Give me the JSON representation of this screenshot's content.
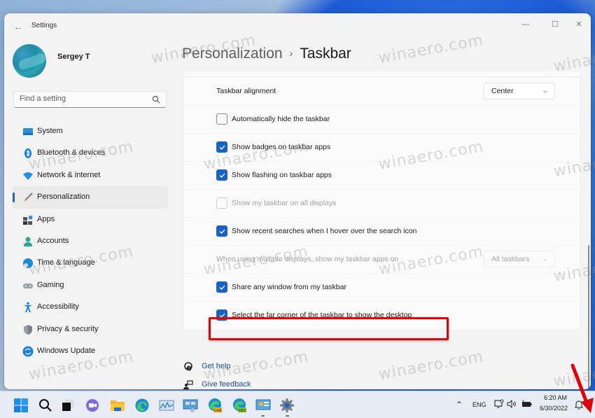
{
  "window": {
    "title": "Settings",
    "controls": {
      "minimize": "—",
      "maximize": "☐",
      "close": "✕"
    }
  },
  "user": {
    "name": "Sergey T"
  },
  "search": {
    "placeholder": "Find a setting"
  },
  "nav": {
    "active": "Personalization",
    "items": [
      {
        "label": "System",
        "icon": "monitor-icon"
      },
      {
        "label": "Bluetooth & devices",
        "icon": "bluetooth-icon"
      },
      {
        "label": "Network & internet",
        "icon": "wifi-icon"
      },
      {
        "label": "Personalization",
        "icon": "brush-icon"
      },
      {
        "label": "Apps",
        "icon": "apps-icon"
      },
      {
        "label": "Accounts",
        "icon": "person-icon"
      },
      {
        "label": "Time & language",
        "icon": "globe-clock-icon"
      },
      {
        "label": "Gaming",
        "icon": "gamepad-icon"
      },
      {
        "label": "Accessibility",
        "icon": "accessibility-icon"
      },
      {
        "label": "Privacy & security",
        "icon": "shield-icon"
      },
      {
        "label": "Windows Update",
        "icon": "update-icon"
      }
    ]
  },
  "breadcrumb": {
    "parent": "Personalization",
    "separator": "›",
    "current": "Taskbar"
  },
  "settings": {
    "alignment": {
      "label": "Taskbar alignment",
      "value": "Center"
    },
    "options": [
      {
        "label": "Automatically hide the taskbar",
        "checked": false,
        "disabled": false
      },
      {
        "label": "Show badges on taskbar apps",
        "checked": true,
        "disabled": false
      },
      {
        "label": "Show flashing on taskbar apps",
        "checked": true,
        "disabled": false
      },
      {
        "label": "Show my taskbar on all displays",
        "checked": false,
        "disabled": true
      },
      {
        "label": "Show recent searches when I hover over the search icon",
        "checked": true,
        "disabled": false
      }
    ],
    "multi_display": {
      "label": "When using multiple displays, show my taskbar apps on",
      "value": "All taskbars",
      "disabled": true
    },
    "options2": [
      {
        "label": "Share any window from my taskbar",
        "checked": true,
        "disabled": false
      },
      {
        "label": "Select the far corner of the taskbar to show the desktop",
        "checked": true,
        "disabled": false,
        "highlighted": true
      }
    ]
  },
  "help": {
    "get_help": "Get help",
    "give_feedback": "Give feedback"
  },
  "taskbar": {
    "apps": [
      "start",
      "search",
      "task-view",
      "teams-chat",
      "file-explorer",
      "edge",
      "performance-monitor",
      "remote-desktop",
      "edge-canary",
      "edge-dev",
      "control-panel",
      "settings"
    ],
    "tray": {
      "language": "ENG",
      "time": "6:20 AM",
      "date": "6/30/2022"
    }
  },
  "accent_colors": {
    "checkbox": "#1a63c3",
    "highlight": "#e00000",
    "link": "#1f4f8f"
  },
  "watermark": "winaero.com"
}
